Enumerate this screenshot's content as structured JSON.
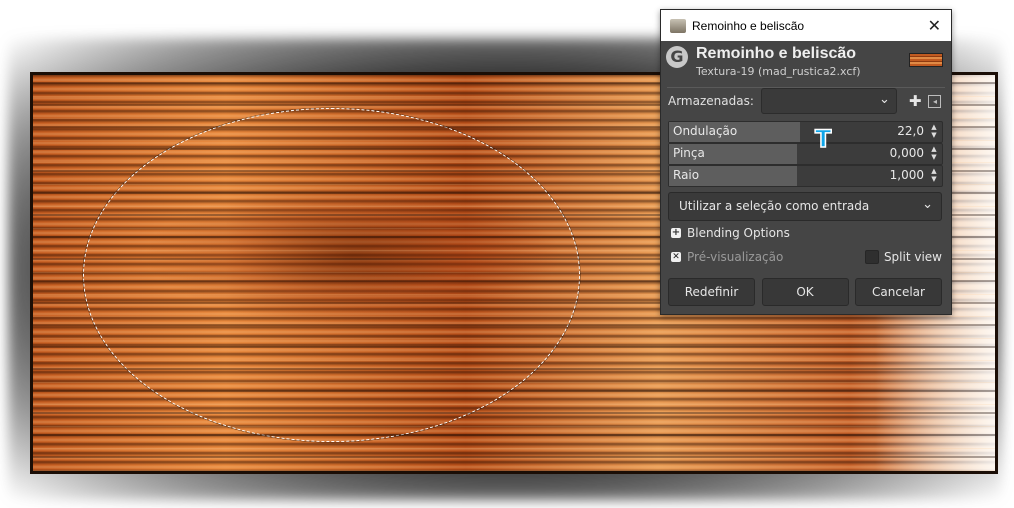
{
  "dialog": {
    "window_title": "Remoinho e beliscão",
    "heading": "Remoinho e beliscão",
    "subtitle": "Textura-19 (mad_rustica2.xcf)",
    "presets_label": "Armazenadas:",
    "presets_value": "",
    "params": [
      {
        "label": "Ondulação",
        "value": "22,0",
        "level": 0.48
      },
      {
        "label": "Pinça",
        "value": "0,000",
        "level": 0.47
      },
      {
        "label": "Raio",
        "value": "1,000",
        "level": 0.47
      }
    ],
    "input_mode": "Utilizar a seleção como entrada",
    "blending_options": "Blending Options",
    "preview_label": "Pré-visualização",
    "split_view_label": "Split view",
    "buttons": {
      "reset": "Redefinir",
      "ok": "OK",
      "cancel": "Cancelar"
    }
  },
  "icons": {
    "close": "close-icon",
    "plus": "add-preset-icon",
    "logo": "gimp-logo-icon"
  }
}
